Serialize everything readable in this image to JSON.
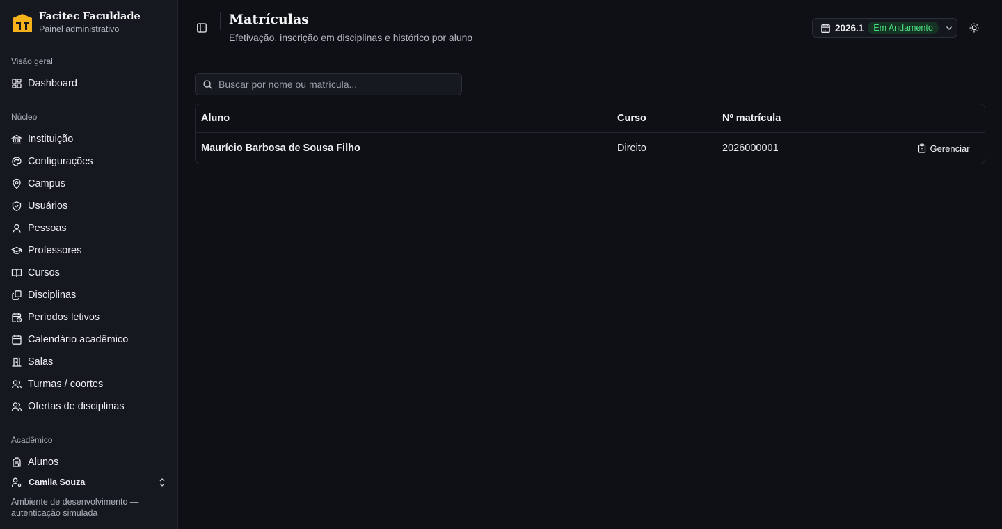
{
  "brand": {
    "title": "Facitec Faculdade",
    "subtitle": "Painel administrativo"
  },
  "sidebar": {
    "sections": [
      {
        "label": "Visão geral",
        "items": [
          {
            "label": "Dashboard",
            "icon": "dashboard-icon"
          }
        ]
      },
      {
        "label": "Núcleo",
        "items": [
          {
            "label": "Instituição",
            "icon": "landmark-icon"
          },
          {
            "label": "Configurações",
            "icon": "palette-icon"
          },
          {
            "label": "Campus",
            "icon": "map-pin-icon"
          },
          {
            "label": "Usuários",
            "icon": "shield-icon"
          },
          {
            "label": "Pessoas",
            "icon": "user-icon"
          },
          {
            "label": "Professores",
            "icon": "graduation-cap-icon"
          },
          {
            "label": "Cursos",
            "icon": "book-open-icon"
          },
          {
            "label": "Disciplinas",
            "icon": "copy-icon"
          },
          {
            "label": "Períodos letivos",
            "icon": "calendar-clock-icon"
          },
          {
            "label": "Calendário acadêmico",
            "icon": "calendar-icon"
          },
          {
            "label": "Salas",
            "icon": "door-icon"
          },
          {
            "label": "Turmas / coortes",
            "icon": "users-icon"
          },
          {
            "label": "Ofertas de disciplinas",
            "icon": "users-icon"
          }
        ]
      },
      {
        "label": "Acadêmico",
        "items": [
          {
            "label": "Alunos",
            "icon": "backpack-icon"
          }
        ]
      }
    ],
    "user": {
      "name": "Camila Souza"
    },
    "dev_note": "Ambiente de desenvolvimento — autenticação simulada"
  },
  "header": {
    "title": "Matrículas",
    "subtitle": "Efetivação, inscrição em disciplinas e histórico por aluno",
    "period": {
      "code": "2026.1",
      "status": "Em Andamento"
    }
  },
  "search": {
    "placeholder": "Buscar por nome ou matrícula...",
    "value": ""
  },
  "table": {
    "columns": [
      "Aluno",
      "Curso",
      "Nº matrícula"
    ],
    "rows": [
      {
        "aluno": "Maurício Barbosa de Sousa Filho",
        "curso": "Direito",
        "matricula": "2026000001",
        "action": "Gerenciar"
      }
    ]
  },
  "colors": {
    "background": "#0e1015",
    "sidebar": "#15181e",
    "brand_gold": "#f6b21a",
    "status_green": "#4ade80"
  }
}
